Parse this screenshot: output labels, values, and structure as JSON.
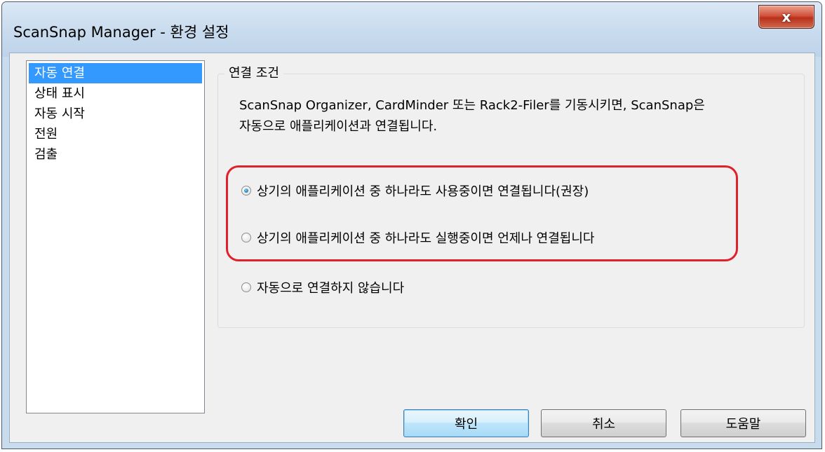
{
  "window": {
    "title": "ScanSnap Manager - 환경 설정",
    "close_label": "x"
  },
  "sidebar": {
    "items": [
      {
        "label": "자동 연결",
        "selected": true
      },
      {
        "label": "상태 표시",
        "selected": false
      },
      {
        "label": "자동 시작",
        "selected": false
      },
      {
        "label": "전원",
        "selected": false
      },
      {
        "label": "검출",
        "selected": false
      }
    ]
  },
  "group": {
    "title": "연결 조건",
    "description_line1": "ScanSnap Organizer, CardMinder 또는 Rack2-Filer를 기동시키면, ScanSnap은",
    "description_line2": "자동으로 애플리케이션과 연결됩니다.",
    "options": [
      {
        "label": "상기의 애플리케이션 중 하나라도 사용중이면 연결됩니다(권장)",
        "checked": true
      },
      {
        "label": "상기의 애플리케이션 중 하나라도 실행중이면 언제나 연결됩니다",
        "checked": false
      },
      {
        "label": "자동으로 연결하지 않습니다",
        "checked": false
      }
    ]
  },
  "buttons": {
    "ok": "확인",
    "cancel": "취소",
    "help": "도움말"
  },
  "colors": {
    "selection": "#3399ff",
    "highlight_border": "#e0212a",
    "close_button": "#c74a32"
  }
}
